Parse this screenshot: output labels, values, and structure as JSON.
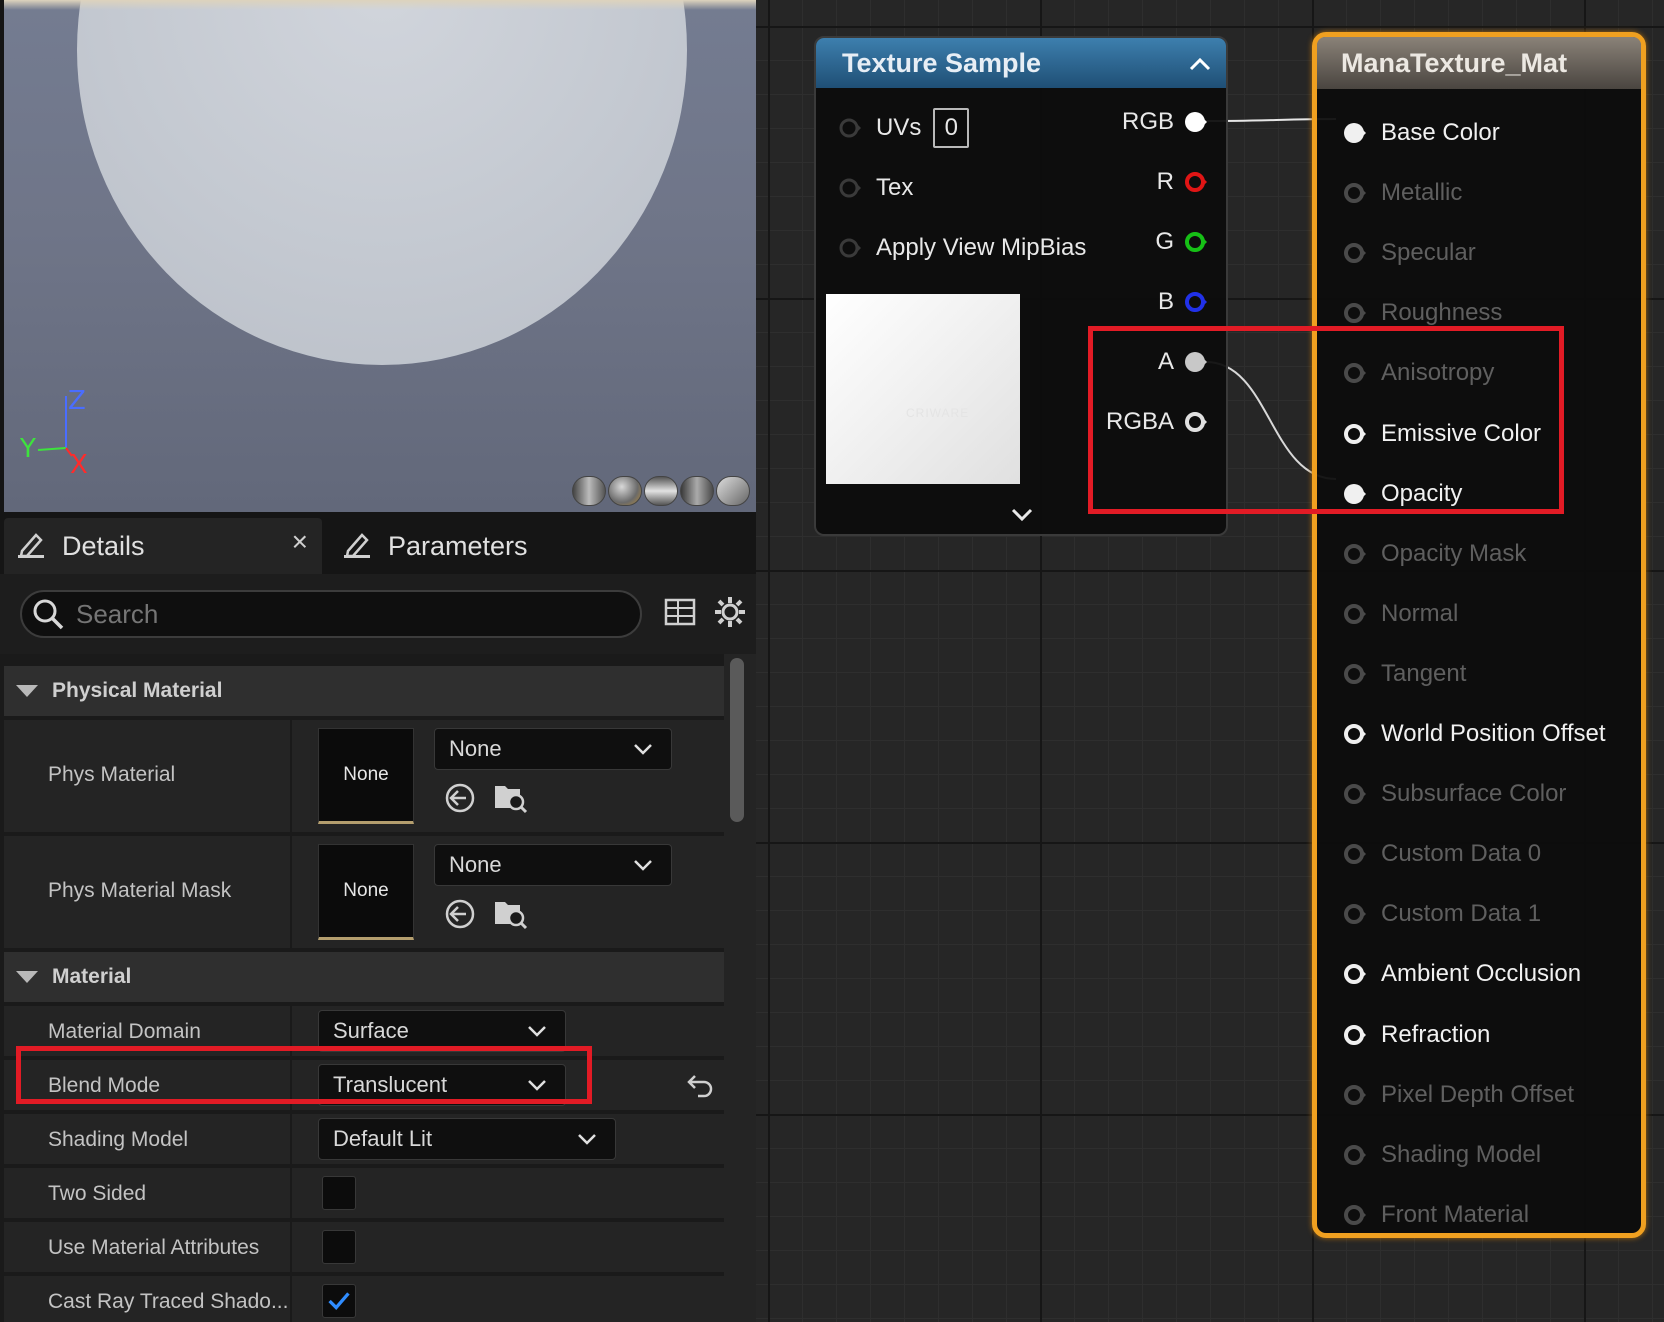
{
  "viewport": {
    "axes": {
      "z": "Z",
      "y": "Y",
      "x": "X"
    },
    "preview_shapes": [
      "cylinder-icon",
      "sphere-icon",
      "plane-icon",
      "cube-icon",
      "mesh-icon"
    ],
    "colors": {
      "z": "#4a6dff",
      "y": "#3de33d",
      "x": "#ff2b2b"
    }
  },
  "details": {
    "tabs": {
      "details": "Details",
      "parameters": "Parameters",
      "close": "×"
    },
    "search": {
      "placeholder": "Search"
    },
    "physical_material": {
      "title": "Physical Material",
      "phys_material": {
        "label": "Phys Material",
        "thumb": "None",
        "value": "None"
      },
      "phys_material_mask": {
        "label": "Phys Material Mask",
        "thumb": "None",
        "value": "None"
      }
    },
    "material": {
      "title": "Material",
      "domain": {
        "label": "Material Domain",
        "value": "Surface"
      },
      "blend": {
        "label": "Blend Mode",
        "value": "Translucent"
      },
      "shading": {
        "label": "Shading Model",
        "value": "Default Lit"
      },
      "two_sided": {
        "label": "Two Sided",
        "checked": false
      },
      "use_attr": {
        "label": "Use Material Attributes",
        "checked": false
      },
      "cast_ray": {
        "label": "Cast Ray Traced Shado...",
        "checked": true
      }
    }
  },
  "texture_node": {
    "title": "Texture Sample",
    "inputs": {
      "uvs": "UVs",
      "uv_value": "0",
      "tex": "Tex",
      "mip": "Apply View MipBias"
    },
    "outputs": {
      "rgb": "RGB",
      "r": "R",
      "g": "G",
      "b": "B",
      "a": "A",
      "rgba": "RGBA"
    },
    "watermark": "CRIWARE",
    "pin_colors": {
      "r": "#e01515",
      "g": "#16c016",
      "b": "#2131e8",
      "a": "#c8c8c8"
    }
  },
  "material_node": {
    "title": "ManaTexture_Mat",
    "pins": [
      {
        "label": "Base Color",
        "active": true
      },
      {
        "label": "Metallic",
        "active": false
      },
      {
        "label": "Specular",
        "active": false
      },
      {
        "label": "Roughness",
        "active": false
      },
      {
        "label": "Anisotropy",
        "active": false
      },
      {
        "label": "Emissive Color",
        "active": true
      },
      {
        "label": "Opacity",
        "active": true
      },
      {
        "label": "Opacity Mask",
        "active": false
      },
      {
        "label": "Normal",
        "active": false
      },
      {
        "label": "Tangent",
        "active": false
      },
      {
        "label": "World Position Offset",
        "active": true
      },
      {
        "label": "Subsurface Color",
        "active": false
      },
      {
        "label": "Custom Data 0",
        "active": false
      },
      {
        "label": "Custom Data 1",
        "active": false
      },
      {
        "label": "Ambient Occlusion",
        "active": true
      },
      {
        "label": "Refraction",
        "active": true
      },
      {
        "label": "Pixel Depth Offset",
        "active": false
      },
      {
        "label": "Shading Model",
        "active": false
      },
      {
        "label": "Front Material",
        "active": false
      }
    ],
    "border_color": "#f0a020"
  },
  "highlight_color": "#e21b25"
}
